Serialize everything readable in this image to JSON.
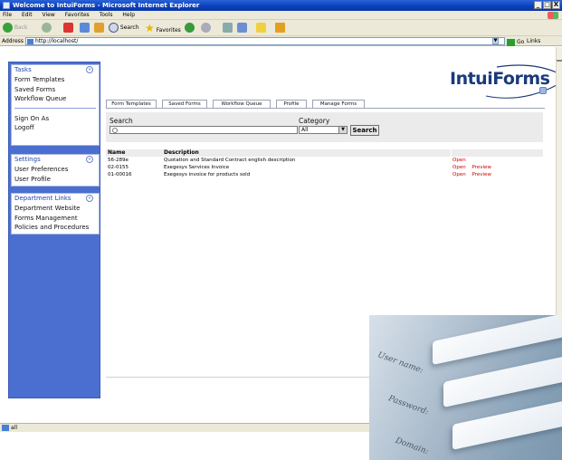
{
  "window": {
    "title": "Welcome to IntuiForms - Microsoft Internet Explorer",
    "buttons": [
      "_",
      "□",
      "X"
    ]
  },
  "menu": [
    "File",
    "Edit",
    "View",
    "Favorites",
    "Tools",
    "Help"
  ],
  "toolbar": {
    "back": "Back",
    "search": "Search",
    "favorites": "Favorites"
  },
  "address": {
    "label": "Address",
    "value": "http://localhost/",
    "go": "Go",
    "links": "Links"
  },
  "sidebar": {
    "tasks": {
      "title": "Tasks",
      "items": [
        "Form Templates",
        "Saved Forms",
        "Workflow Queue"
      ],
      "items2": [
        "Sign On As",
        "Logoff"
      ]
    },
    "settings": {
      "title": "Settings",
      "items": [
        "User Preferences",
        "User Profile"
      ]
    },
    "links": {
      "title": "Department Links",
      "items": [
        "Department Website",
        "Forms Management",
        "Policies and Procedures"
      ]
    },
    "collapse_glyph": "«"
  },
  "logo": {
    "text": "IntuiForms"
  },
  "tabs": [
    "Form Templates",
    "Saved Forms",
    "Workflow Queue",
    "Profile",
    "Manage Forms"
  ],
  "search": {
    "label": "Search",
    "value": "",
    "category_label": "Category",
    "category_value": "All",
    "button": "Search"
  },
  "table": {
    "headers": {
      "name": "Name",
      "description": "Description"
    },
    "rows": [
      {
        "name": "56-289e",
        "description": "Quotation and Standard Contract english description",
        "actions": [
          "Open"
        ]
      },
      {
        "name": "02-0155",
        "description": "Exegesys Services Invoice",
        "actions": [
          "Open",
          "Preview"
        ]
      },
      {
        "name": "01-00016",
        "description": "Exegesys invoice for products sold",
        "actions": [
          "Open",
          "Preview"
        ]
      }
    ]
  },
  "status": {
    "text": "all"
  },
  "photo": {
    "labels": [
      "User name:",
      "Password:",
      "Domain:"
    ]
  },
  "colors": {
    "sidebar": "#4a6fd0",
    "action_link": "#d00000",
    "titlebar": "#0a3fb8",
    "logo": "#1a3a7a"
  }
}
